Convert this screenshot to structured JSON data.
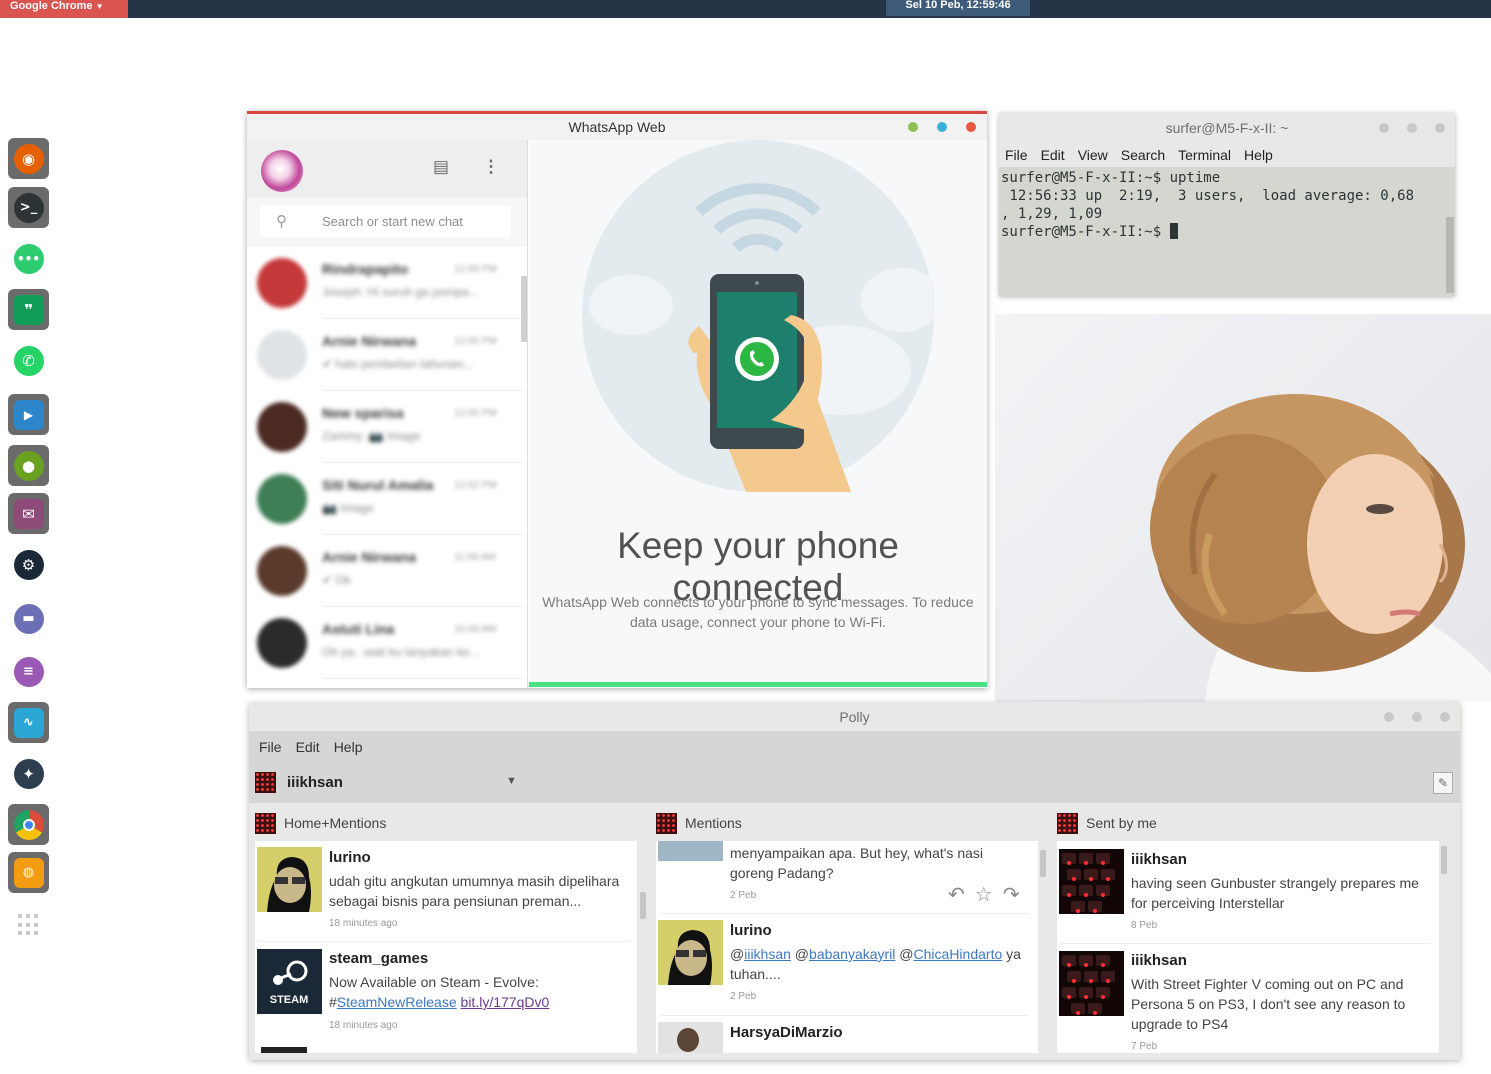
{
  "top_panel": {
    "app_menu": "Google Chrome",
    "clock": "Sel 10 Peb, 12:59:46"
  },
  "dock": {
    "items": [
      {
        "name": "firefox-icon",
        "color": "#e66000"
      },
      {
        "name": "terminal-icon",
        "color": "#2e3436"
      },
      {
        "name": "chat-icon",
        "color": "#2ecc71"
      },
      {
        "name": "hangouts-icon",
        "color": "#0f9d58"
      },
      {
        "name": "whatsapp-icon",
        "color": "#25d366"
      },
      {
        "name": "media-player-icon",
        "color": "#2d86c9"
      },
      {
        "name": "app-icon",
        "color": "#6aa121"
      },
      {
        "name": "mail-icon",
        "color": "#8e4b7a"
      },
      {
        "name": "steam-icon",
        "color": "#1b2838"
      },
      {
        "name": "files-icon",
        "color": "#6c6fb5"
      },
      {
        "name": "text-editor-icon",
        "color": "#9b59b6"
      },
      {
        "name": "system-monitor-icon",
        "color": "#2aa7d4"
      },
      {
        "name": "kodi-icon",
        "color": "#2d3e50"
      },
      {
        "name": "chrome-icon",
        "color": "#dd4b39"
      },
      {
        "name": "software-center-icon",
        "color": "#f39c12"
      }
    ]
  },
  "whatsapp": {
    "title": "WhatsApp Web",
    "search_placeholder": "Search or start new chat",
    "chats": [
      {
        "name": "Rindrapapito",
        "time": "12:58 PM",
        "message": "Joseph: Hi suruh ga pompa...",
        "avatar": "#c43a3a"
      },
      {
        "name": "Arnie Nirwana",
        "time": "12:55 PM",
        "message": "✔ halo pembelian tahunan...",
        "avatar": "#dfe3e6"
      },
      {
        "name": "New sparisa",
        "time": "12:55 PM",
        "message": "Zammy: 📷 Image",
        "avatar": "#4b2a22"
      },
      {
        "name": "Siti Nurul Amalia",
        "time": "12:52 PM",
        "message": "📷 Image",
        "avatar": "#3f7f55"
      },
      {
        "name": "Arnie Nirwana",
        "time": "11:58 AM",
        "message": "✔ Ok",
        "avatar": "#5a3a2a"
      },
      {
        "name": "Astuti Lina",
        "time": "10:48 AM",
        "message": "Oh ya.. wait ku tanyakan ke...",
        "avatar": "#2b2b2b"
      }
    ],
    "heading": "Keep your phone connected",
    "description": "WhatsApp Web connects to your phone to sync messages. To reduce data usage, connect your phone to Wi-Fi.",
    "accent": "#4adf83",
    "title_bar_accent": "#d9453c"
  },
  "terminal": {
    "title": "surfer@M5-F-x-II: ~",
    "menu": [
      "File",
      "Edit",
      "View",
      "Search",
      "Terminal",
      "Help"
    ],
    "lines": [
      "surfer@M5-F-x-II:~$ uptime",
      " 12:56:33 up  2:19,  3 users,  load average: 0,68",
      ", 1,29, 1,09",
      "surfer@M5-F-x-II:~$ "
    ]
  },
  "polly": {
    "title": "Polly",
    "menu": [
      "File",
      "Edit",
      "Help"
    ],
    "account": "iiikhsan",
    "columns": [
      {
        "title": "Home+Mentions",
        "tweets": [
          {
            "user": "lurino",
            "text": "udah gitu angkutan umumnya masih dipelihara sebagai bisnis para pensiunan preman...",
            "time": "18 minutes ago"
          },
          {
            "user": "steam_games",
            "text_prefix": "Now Available on Steam - Evolve: #",
            "hashtag": "SteamNewRelease",
            "url": "bit.ly/177qDv0",
            "time": "18 minutes ago",
            "avatar_label": "STEAM"
          }
        ]
      },
      {
        "title": "Mentions",
        "tweets": [
          {
            "text": "menyampaikan apa. But hey, what's nasi goreng Padang?",
            "time": "2 Peb"
          },
          {
            "user": "lurino",
            "at1": "iiikhsan",
            "at2": "babanyakayril",
            "at3": "ChicaHindarto",
            "text_suffix": " ya tuhan....",
            "time": "2 Peb"
          },
          {
            "user": "HarsyaDiMarzio"
          }
        ]
      },
      {
        "title": "Sent by me",
        "tweets": [
          {
            "user": "iiikhsan",
            "text": "having seen Gunbuster strangely prepares me for perceiving Interstellar",
            "time": "8 Peb"
          },
          {
            "user": "iiikhsan",
            "text": "With Street Fighter V coming out on PC and Persona 5 on PS3, I don't see any reason to upgrade to PS4",
            "time": "7 Peb"
          }
        ]
      }
    ]
  }
}
